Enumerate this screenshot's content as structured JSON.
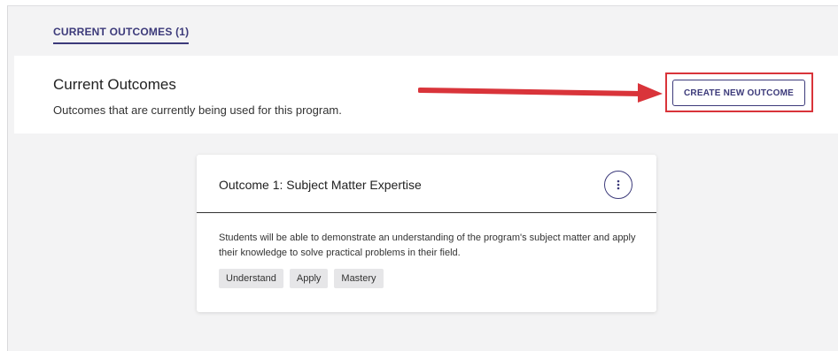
{
  "tabs": [
    {
      "label": "CURRENT OUTCOMES (1)",
      "active": true
    }
  ],
  "header": {
    "title": "Current Outcomes",
    "subtitle": "Outcomes that are currently being used for this program.",
    "create_button_label": "CREATE NEW OUTCOME"
  },
  "annotation": {
    "arrow_color": "#d9343a",
    "highlight_color": "#d9343a"
  },
  "outcomes": [
    {
      "title": "Outcome 1: Subject Matter Expertise",
      "description": "Students will be able to demonstrate an understanding of the program's subject matter and apply their knowledge to solve practical problems in their field.",
      "tags": [
        "Understand",
        "Apply",
        "Mastery"
      ],
      "menu_icon": "kebab-vertical-icon"
    }
  ],
  "colors": {
    "accent": "#3c3a7a",
    "background": "#f3f3f4",
    "tag_bg": "#e6e6e8"
  }
}
